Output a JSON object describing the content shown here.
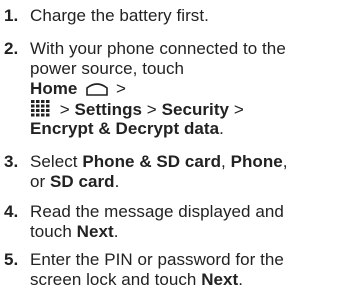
{
  "steps": [
    {
      "number": "1.",
      "text": "Charge the battery first."
    },
    {
      "number": "2.",
      "intro": "With your phone connected to the power source, touch",
      "home": "Home",
      "sep1": ">",
      "sep2": ">",
      "settings": "Settings",
      "sep3": ">",
      "security": "Security",
      "sep4": ">",
      "encrypt": "Encrypt & Decrypt data",
      "end": ".",
      "icons": [
        "home-icon",
        "apps-grid-icon"
      ]
    },
    {
      "number": "3.",
      "pre": "Select",
      "opt1": "Phone & SD card",
      "mid1": ",",
      "opt2": "Phone",
      "mid2": ",",
      "mid3": "or",
      "opt3": "SD card",
      "end": "."
    },
    {
      "number": "4.",
      "pre": "Read the message displayed and touch",
      "next": "Next",
      "end": "."
    },
    {
      "number": "5.",
      "pre": "Enter the PIN or password for the screen lock and touch",
      "next": "Next",
      "end": "."
    }
  ]
}
